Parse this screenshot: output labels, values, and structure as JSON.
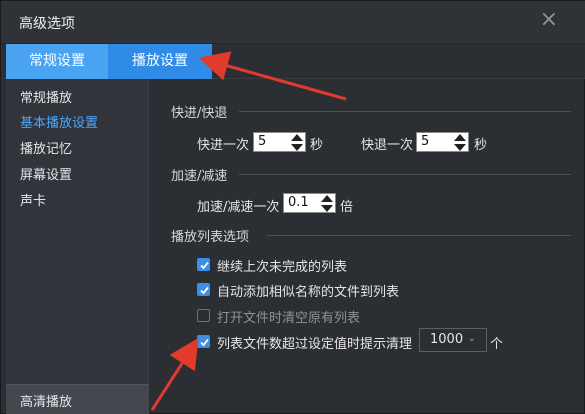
{
  "window": {
    "title": "高级选项",
    "close_glyph": "×"
  },
  "tabs": [
    {
      "label": "常规设置",
      "active": false
    },
    {
      "label": "播放设置",
      "active": true
    }
  ],
  "sidebar": {
    "items": [
      {
        "label": "常规播放",
        "active": false
      },
      {
        "label": "基本播放设置",
        "active": true
      },
      {
        "label": "播放记忆",
        "active": false
      },
      {
        "label": "屏幕设置",
        "active": false
      },
      {
        "label": "声卡",
        "active": false
      }
    ],
    "bottom_item": "高清播放"
  },
  "sections": {
    "seek": {
      "title": "快进/快退",
      "forward_label": "快进一次",
      "forward_value": "5",
      "forward_unit": "秒",
      "backward_label": "快退一次",
      "backward_value": "5",
      "backward_unit": "秒"
    },
    "speed": {
      "title": "加速/减速",
      "step_label": "加速/减速一次",
      "step_value": "0.1",
      "step_unit": "倍"
    },
    "playlist": {
      "title": "播放列表选项",
      "options": [
        {
          "label": "继续上次未完成的列表",
          "checked": true,
          "enabled": true
        },
        {
          "label": "自动添加相似名称的文件到列表",
          "checked": true,
          "enabled": true
        },
        {
          "label": "打开文件时清空原有列表",
          "checked": false,
          "enabled": false
        },
        {
          "label": "列表文件数超过设定值时提示清理",
          "checked": true,
          "enabled": true
        }
      ],
      "limit_value": "1000",
      "limit_unit": "个"
    }
  },
  "colors": {
    "accent": "#2f8be6",
    "active_text": "#49a8ff",
    "annotation_arrow": "#e23b2e"
  }
}
